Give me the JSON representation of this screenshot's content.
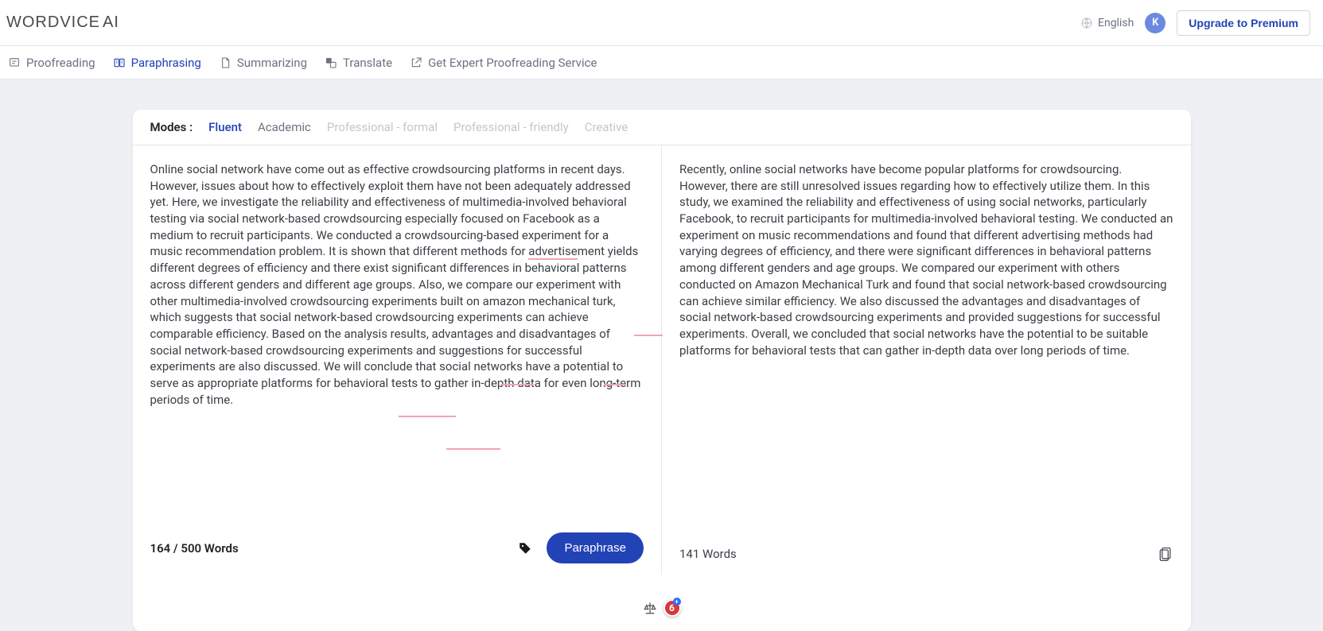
{
  "header": {
    "logo_main": "WORDVICE",
    "logo_suffix": "AI",
    "language": "English",
    "avatar_initial": "K",
    "upgrade_label": "Upgrade to Premium"
  },
  "nav": {
    "proofreading": "Proofreading",
    "paraphrasing": "Paraphrasing",
    "summarizing": "Summarizing",
    "translate": "Translate",
    "expert": "Get Expert Proofreading Service"
  },
  "modes": {
    "label": "Modes :",
    "fluent": "Fluent",
    "academic": "Academic",
    "pro_formal": "Professional - formal",
    "pro_friendly": "Professional - friendly",
    "creative": "Creative"
  },
  "input": {
    "text_before": "Online social network have come out as effective crowdsourcing platforms in recent days. However, issues about how to effectively exploit them have not been adequately addressed yet. Here, we investigate the reliability and effectiveness of multimedia-involved behavioral testing via social network-based crowdsourcing especially focused on Facebook as a medium to recruit participants. We conducted a crowdsourcing-based experiment for a music recommendation problem. It is shown that different methods for ",
    "text_underlined": "advertise",
    "text_after": "ment yields different degrees of efficiency and there exist significant differences in behavioral patterns across different genders and different age groups.  Also, we compare our experiment with other multimedia-involved crowdsourcing experiments built on amazon mechanical turk, which suggests that social network-based crowdsourcing experiments can achieve comparable efficiency. Based on the analysis results, advantages and disadvantages of social network-based crowdsourcing experiments and suggestions for successful experiments are also discussed. We will conclude that social networks have a potential to serve as appropriate platforms for behavioral tests to gather in-depth data for even long-term periods of time.",
    "word_count": "164 / 500 Words",
    "button": "Paraphrase"
  },
  "output": {
    "text": "Recently, online social networks have become popular platforms for crowdsourcing. However, there are still unresolved issues regarding how to effectively utilize them. In this study, we examined the reliability and effectiveness of using social networks, particularly Facebook, to recruit participants for multimedia-involved behavioral testing. We conducted an experiment on music recommendations and found that different advertising methods had varying degrees of efficiency, and there were significant differences in behavioral patterns among different genders and age groups. We compared our experiment with others conducted on Amazon Mechanical Turk and found that social network-based crowdsourcing can achieve similar efficiency. We also discussed the advantages and disadvantages of social network-based crowdsourcing experiments and provided suggestions for successful experiments. Overall, we concluded that social networks have the potential to be suitable platforms for behavioral tests that can gather in-depth data over long periods of time.",
    "word_count": "141 Words"
  },
  "widgets": {
    "badge_count": "6"
  }
}
